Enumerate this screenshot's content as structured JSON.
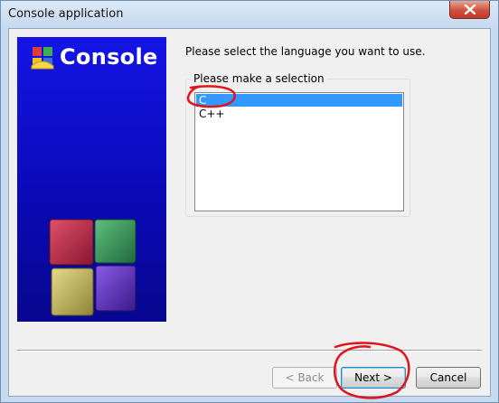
{
  "window": {
    "title": "Console application"
  },
  "banner": {
    "title": "Console"
  },
  "prompt": "Please select the language you want to use.",
  "selection_group": {
    "label": "Please make a selection",
    "options": [
      "C",
      "C++"
    ],
    "selected": "C"
  },
  "buttons": {
    "back": "< Back",
    "next": "Next >",
    "cancel": "Cancel"
  },
  "icons": {
    "close": "close-icon",
    "app_logo": "codeblocks-logo-icon",
    "cubes": "colored-cubes-graphic"
  },
  "colors": {
    "banner_blue": "#1515e6",
    "selection": "#3399ff",
    "annotation_red": "#e0151c"
  }
}
